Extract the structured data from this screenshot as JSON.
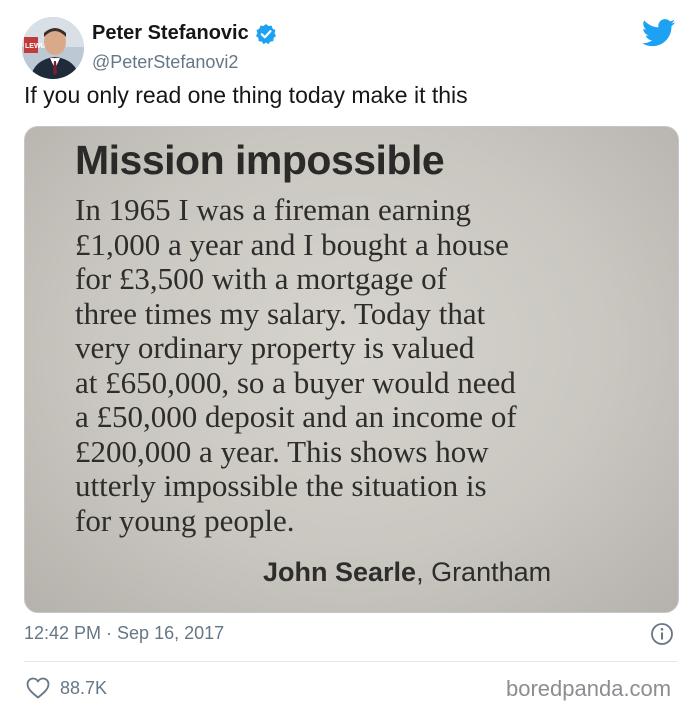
{
  "author": {
    "display_name": "Peter Stefanovic",
    "handle": "@PeterStefanovi2",
    "avatar_badge": "LEWU",
    "verified": true
  },
  "tweet": {
    "text": "If you only read one thing today make it this",
    "timestamp": "12:42 PM · Sep 16, 2017",
    "likes": "88.7K"
  },
  "clipping": {
    "title": "Mission impossible",
    "body_lines": [
      "In 1965 I was a fireman earning",
      "£1,000 a year and I bought a house",
      "for £3,500 with a mortgage of",
      "three times my salary. Today that",
      "very ordinary property is valued",
      "at £650,000, so a buyer would need",
      "a £50,000 deposit and an income of",
      "£200,000 a year. This shows how",
      "utterly impossible the situation is",
      "for young people."
    ],
    "signature_name": "John Searle",
    "signature_place": ", Grantham"
  },
  "watermark": "boredpanda.com",
  "colors": {
    "twitter_blue": "#1da1f2",
    "secondary_text": "#657786"
  },
  "icons": [
    "verified-badge-icon",
    "twitter-bird-icon",
    "info-icon",
    "heart-icon"
  ]
}
